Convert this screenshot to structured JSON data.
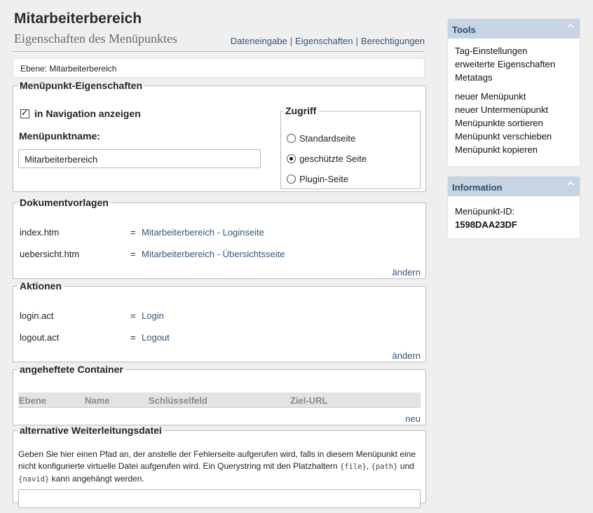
{
  "header": {
    "title": "Mitarbeiterbereich",
    "subtitle": "Eigenschaften des Menüpunktes",
    "links": [
      "Dateneingabe",
      "Eigenschaften",
      "Berechtigungen"
    ],
    "separator": "|"
  },
  "level": {
    "text": "Ebene: Mitarbeiterbereich"
  },
  "props": {
    "legend": "Menüpunkt-Eigenschaften",
    "show_in_nav_label": "in Navigation anzeigen",
    "show_in_nav_checked": true,
    "name_label": "Menüpunktname:",
    "name_value": "Mitarbeiterbereich",
    "access": {
      "legend": "Zugriff",
      "options": [
        "Standardseite",
        "geschützte Seite",
        "Plugin-Seite"
      ],
      "selected": "geschützte Seite"
    }
  },
  "docs": {
    "legend": "Dokumentvorlagen",
    "rows": [
      {
        "key": "index.htm",
        "eq": "=",
        "value": "Mitarbeiterbereich - Loginseite"
      },
      {
        "key": "uebersicht.htm",
        "eq": "=",
        "value": "Mitarbeiterbereich - Übersichtsseite"
      }
    ],
    "change_label": "ändern"
  },
  "actions": {
    "legend": "Aktionen",
    "rows": [
      {
        "key": "login.act",
        "eq": "=",
        "value": "Login"
      },
      {
        "key": "logout.act",
        "eq": "=",
        "value": "Logout"
      }
    ],
    "change_label": "ändern"
  },
  "containers": {
    "legend": "angeheftete Container",
    "columns": [
      "Ebene",
      "Name",
      "Schlüsselfeld",
      "Ziel-URL"
    ],
    "new_label": "neu"
  },
  "alt": {
    "legend": "alternative Weiterleitungsdatei",
    "text_1": "Geben Sie hier einen Pfad an, der anstelle der Fehlerseite aufgerufen wird, falls in diesem Menüpunkt eine nicht konfigurierte virtuelle Datei aufgerufen wird. Ein Querystring mit den Platzhaltern",
    "ph_file": "{file}",
    "comma": ",",
    "ph_path": "{path}",
    "and": "und",
    "ph_navid": "{navid}",
    "text_2": "kann angehängt werden.",
    "value": ""
  },
  "tools": {
    "title": "Tools",
    "group1": [
      "Tag-Einstellungen",
      "erweiterte Eigenschaften",
      "Metatags"
    ],
    "group2": [
      "neuer Menüpunkt",
      "neuer Untermenüpunkt",
      "Menüpunkte sortieren",
      "Menüpunkt verschieben",
      "Menüpunkt kopieren"
    ]
  },
  "info": {
    "title": "Information",
    "id_label": "Menüpunkt-ID:",
    "id_value": "1598DAA23DF"
  },
  "colors": {
    "panel_header": "#c6d4e3",
    "link": "#33567a",
    "background": "#efefef"
  },
  "icons": {
    "panel_toggle": "chevron-up-icon",
    "checkbox": "checkmark-icon"
  }
}
